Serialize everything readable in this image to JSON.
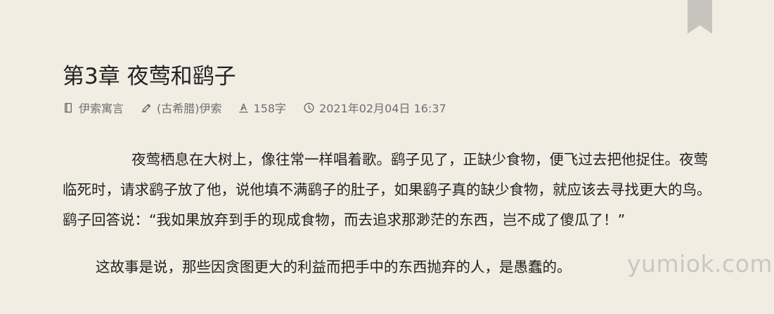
{
  "page": {
    "background": "#f1ede3",
    "bookmark_color": "#c7c4be",
    "watermark": "yumiok.com",
    "watermark_color": "#c9c7c2"
  },
  "chapter": {
    "title": "第3章 夜莺和鹞子"
  },
  "meta": {
    "book": {
      "icon": "book-icon",
      "text": "伊索寓言"
    },
    "author": {
      "icon": "pen-icon",
      "text": "(古希腊)伊索"
    },
    "word_count": {
      "icon": "font-icon",
      "text": "158字"
    },
    "datetime": {
      "icon": "clock-icon",
      "text": "2021年02月04日 16:37"
    }
  },
  "content": {
    "paragraphs": [
      "夜莺栖息在大树上，像往常一样唱着歌。鹞子见了，正缺少食物，便飞过去把他捉住。夜莺临死时，请求鹞子放了他，说他填不满鹞子的肚子，如果鹞子真的缺少食物，就应该去寻找更大的鸟。鹞子回答说：“我如果放弃到手的现成食物，而去追求那渺茫的东西，岂不成了傻瓜了！”",
      "这故事是说，那些因贪图更大的利益而把手中的东西抛弃的人，是愚蠢的。"
    ]
  }
}
